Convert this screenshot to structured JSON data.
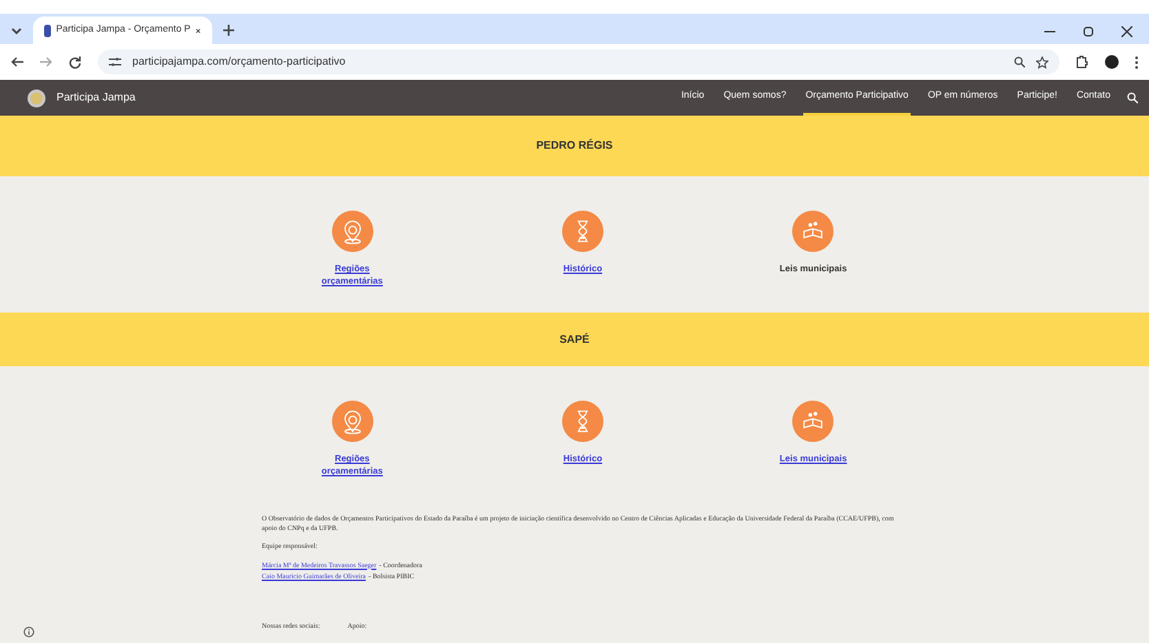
{
  "browser": {
    "tab": {
      "title": "Participa Jampa - Orçamento P"
    },
    "address": "participajampa.com/orçamento-participativo"
  },
  "site": {
    "name": "Participa Jampa",
    "nav": [
      {
        "label": "Início",
        "selected": false
      },
      {
        "label": "Quem somos?",
        "selected": false
      },
      {
        "label": "Orçamento Participativo",
        "selected": true
      },
      {
        "label": "OP em números",
        "selected": false
      },
      {
        "label": "Participe!",
        "selected": false
      },
      {
        "label": "Contato",
        "selected": false
      }
    ]
  },
  "sections": [
    {
      "title": "PEDRO RÉGIS",
      "items": [
        {
          "kind": "pin",
          "label": "Regiões orçamentárias",
          "link": true
        },
        {
          "kind": "hourglass",
          "label": "Histórico",
          "link": true
        },
        {
          "kind": "book",
          "label": "Leis municipais",
          "link": false
        }
      ]
    },
    {
      "title": "SAPÉ",
      "items": [
        {
          "kind": "pin",
          "label": "Regiões orçamentárias",
          "link": true
        },
        {
          "kind": "hourglass",
          "label": "Histórico",
          "link": true
        },
        {
          "kind": "book",
          "label": "Leis municipais",
          "link": true
        }
      ]
    }
  ],
  "footer": {
    "about": "O Observatório de dados de Orçamentos Participativos do Estado da Paraíba é um projeto de iniciação científica desenvolvido no Centro de Ciências Aplicadas e Educação da Universidade Federal da Paraíba (CCAE/UFPB), com apoio do CNPq e da UFPB.",
    "team_heading": "Equipe responsável:",
    "team": [
      {
        "name": "Márcia Mª de Medeiros Travassos Saeger",
        "role": "- Coordenadora"
      },
      {
        "name": "Caio Mauricio Guimarães de Oliveira",
        "role": "- Bolsista PIBIC"
      }
    ],
    "social_heading": "Nossas redes sociais:",
    "support_heading": "Apoio:"
  }
}
